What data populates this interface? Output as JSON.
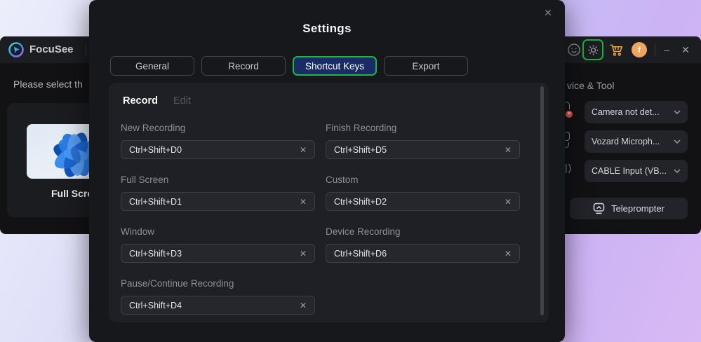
{
  "app": {
    "title": "FocuSee",
    "prompt": "Please select th",
    "card": {
      "label": "Full Scre"
    },
    "titlebar": {
      "badge_letter": "f",
      "minimize_glyph": "–",
      "close_glyph": "✕",
      "cam_error_glyph": "✕"
    },
    "right_panel": {
      "header": "vice & Tool",
      "speaker_fragment": "|)",
      "dropdowns": [
        {
          "label": "Camera not det..."
        },
        {
          "label": "Vozard Microph..."
        },
        {
          "label": "CABLE Input (VB..."
        }
      ],
      "teleprompter": "Teleprompter"
    }
  },
  "modal": {
    "title": "Settings",
    "close_glyph": "✕",
    "tabs": [
      {
        "label": "General",
        "active": false
      },
      {
        "label": "Record",
        "active": false
      },
      {
        "label": "Shortcut Keys",
        "active": true
      },
      {
        "label": "Export",
        "active": false
      }
    ],
    "panel": {
      "tabs": [
        {
          "label": "Record",
          "active": true
        },
        {
          "label": "Edit",
          "active": false
        }
      ],
      "clear_glyph": "✕",
      "fields": [
        {
          "label": "New Recording",
          "value": "Ctrl+Shift+D0"
        },
        {
          "label": "Finish Recording",
          "value": "Ctrl+Shift+D5"
        },
        {
          "label": "Full Screen",
          "value": "Ctrl+Shift+D1"
        },
        {
          "label": "Custom",
          "value": "Ctrl+Shift+D2"
        },
        {
          "label": "Window",
          "value": "Ctrl+Shift+D3"
        },
        {
          "label": "Device Recording",
          "value": "Ctrl+Shift+D6"
        },
        {
          "label": "Pause/Continue Recording",
          "value": "Ctrl+Shift+D4"
        }
      ]
    }
  },
  "colors": {
    "accent_green": "#1fae3e",
    "active_tab_bg": "#1a2c66",
    "cart_orange": "#e8a33d",
    "badge_orange": "#f0a45c",
    "error_red": "#e14b4b",
    "modal_bg": "#17181b",
    "panel_bg": "#1e2025"
  }
}
